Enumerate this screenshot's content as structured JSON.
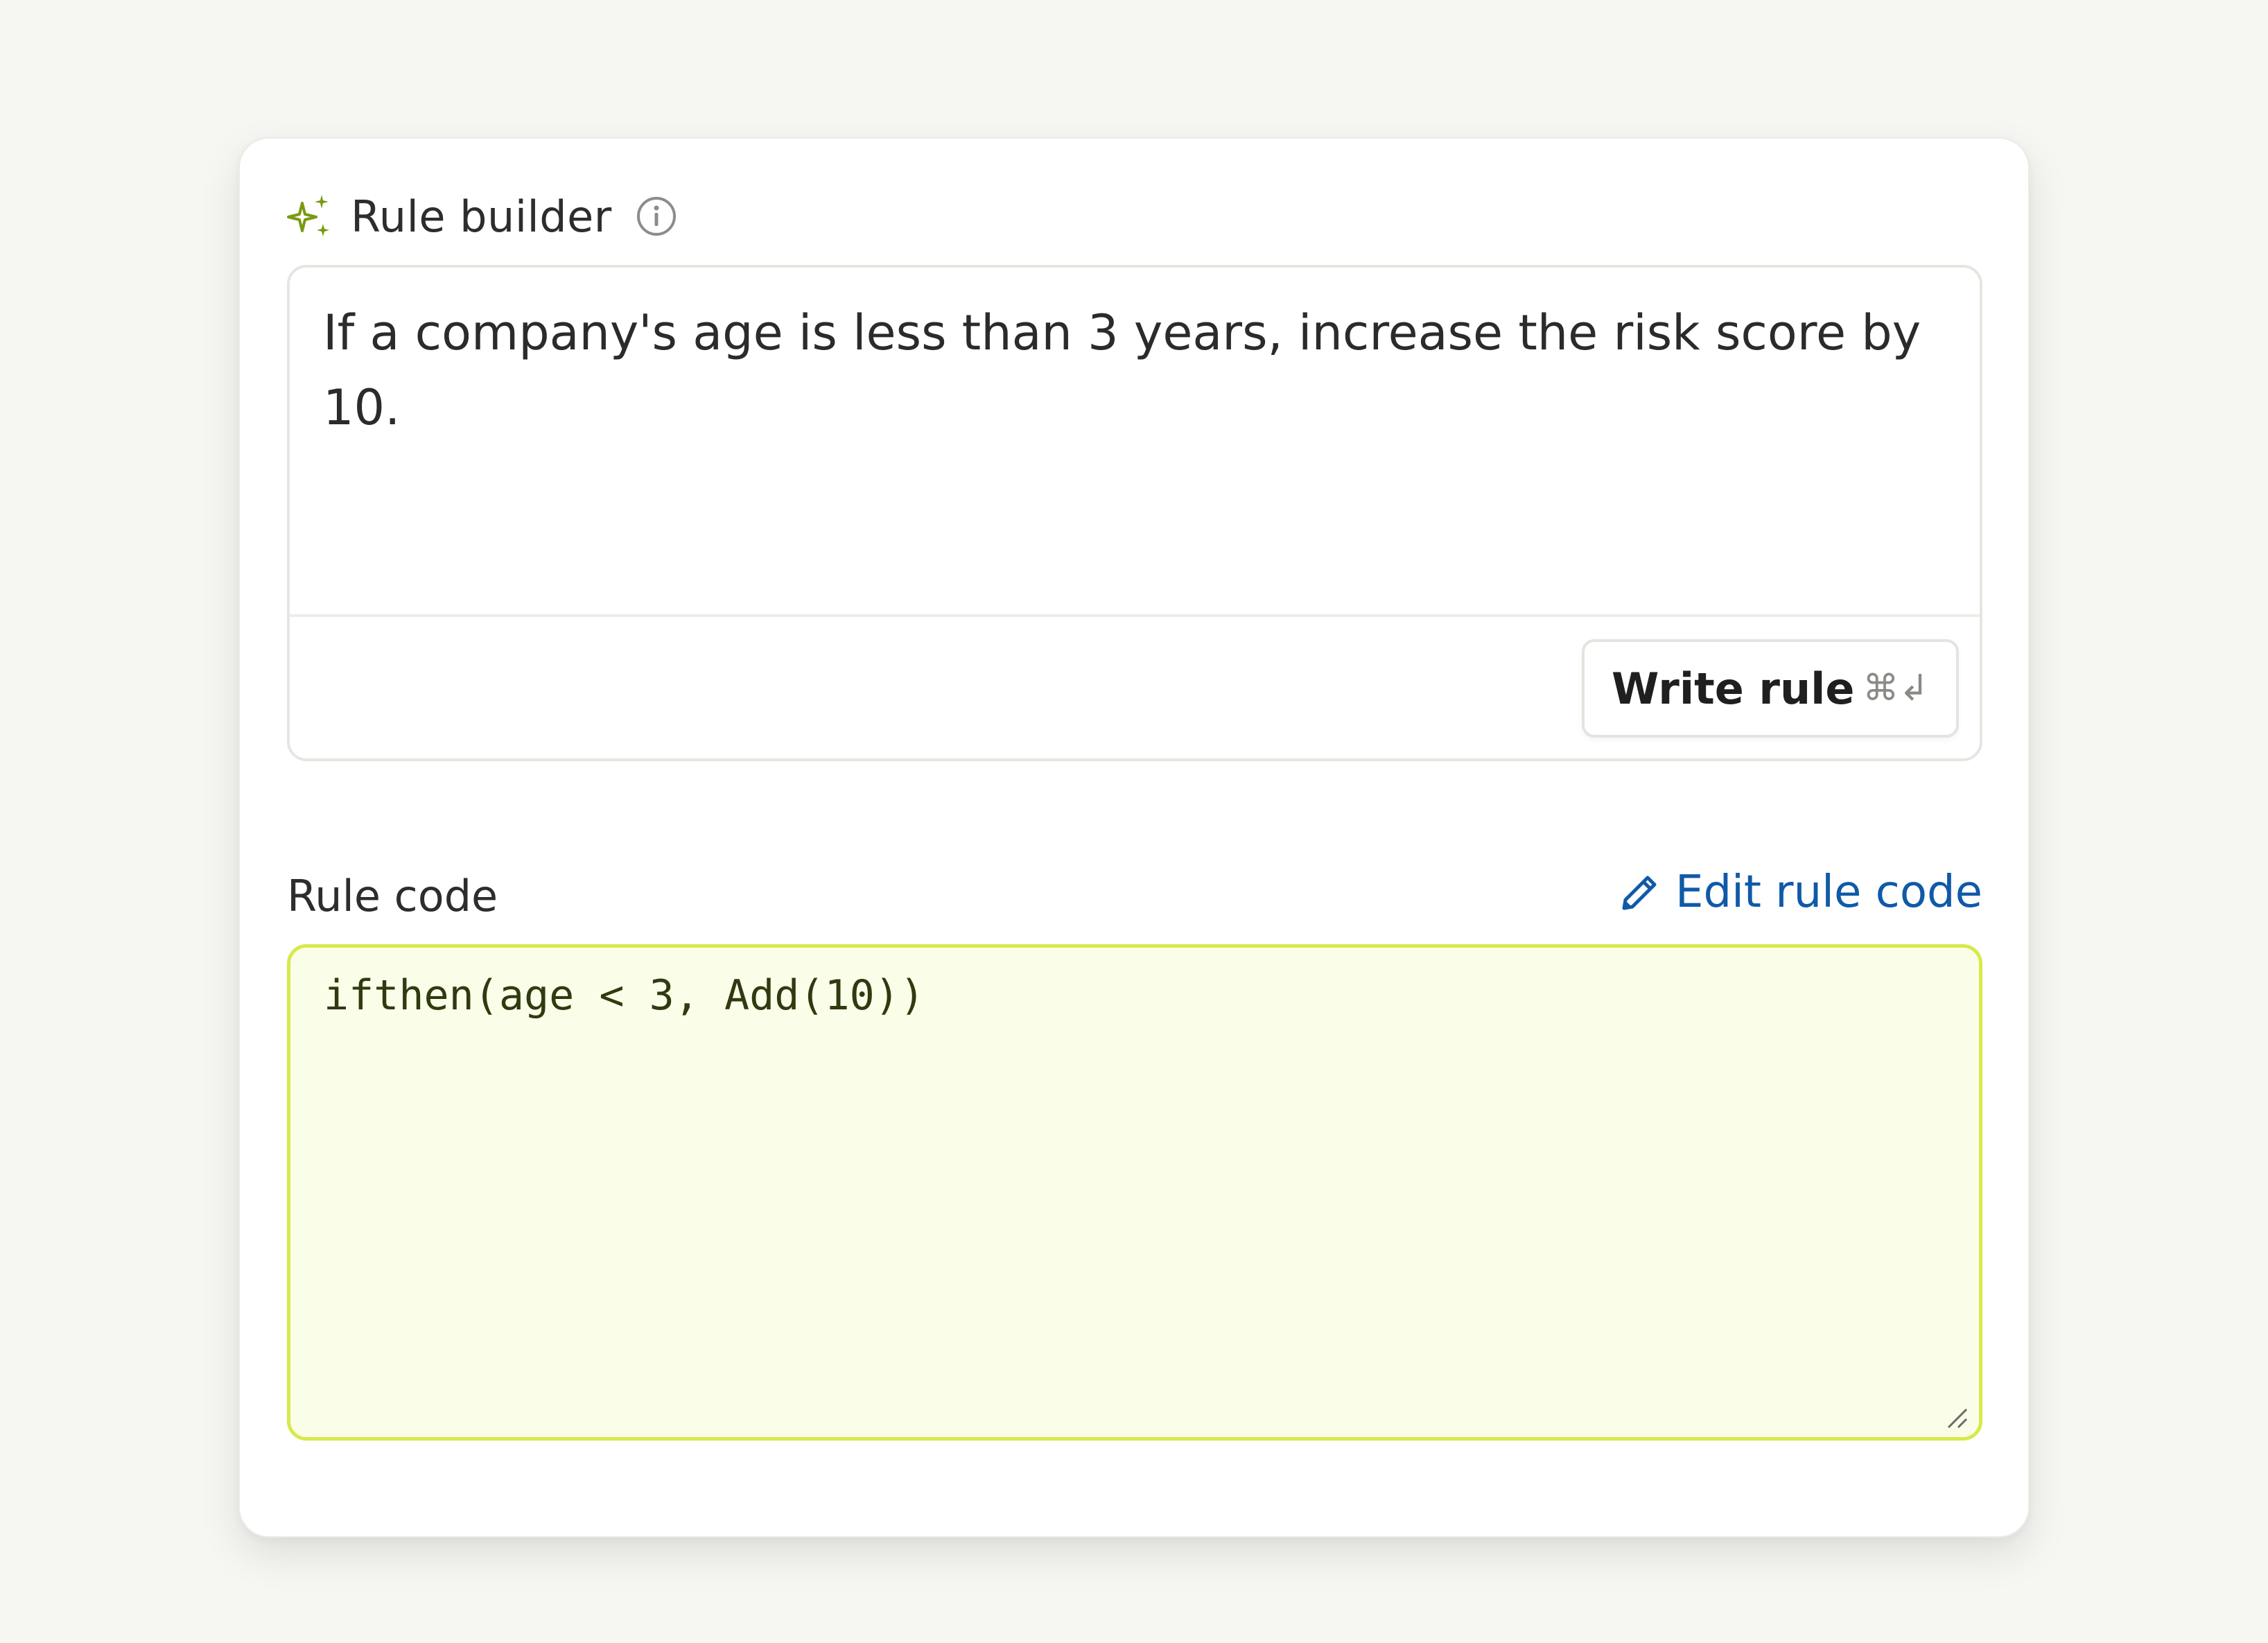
{
  "builder": {
    "title": "Rule builder",
    "icons": {
      "sparkle": "sparkle-icon",
      "info": "info-icon"
    },
    "prompt_text": "If a company's age is less than 3 years, increase the risk score by 10.",
    "write_button": {
      "label": "Write rule",
      "shortcut": "⌘↲"
    }
  },
  "code": {
    "title": "Rule code",
    "edit_label": "Edit rule code",
    "edit_icon": "pencil-icon",
    "value": "ifthen(age < 3, Add(10))"
  },
  "colors": {
    "accent_green": "#7a9a12",
    "link_blue": "#0f5aa8",
    "code_border": "#d6ea4a",
    "code_bg": "#fafde8"
  }
}
